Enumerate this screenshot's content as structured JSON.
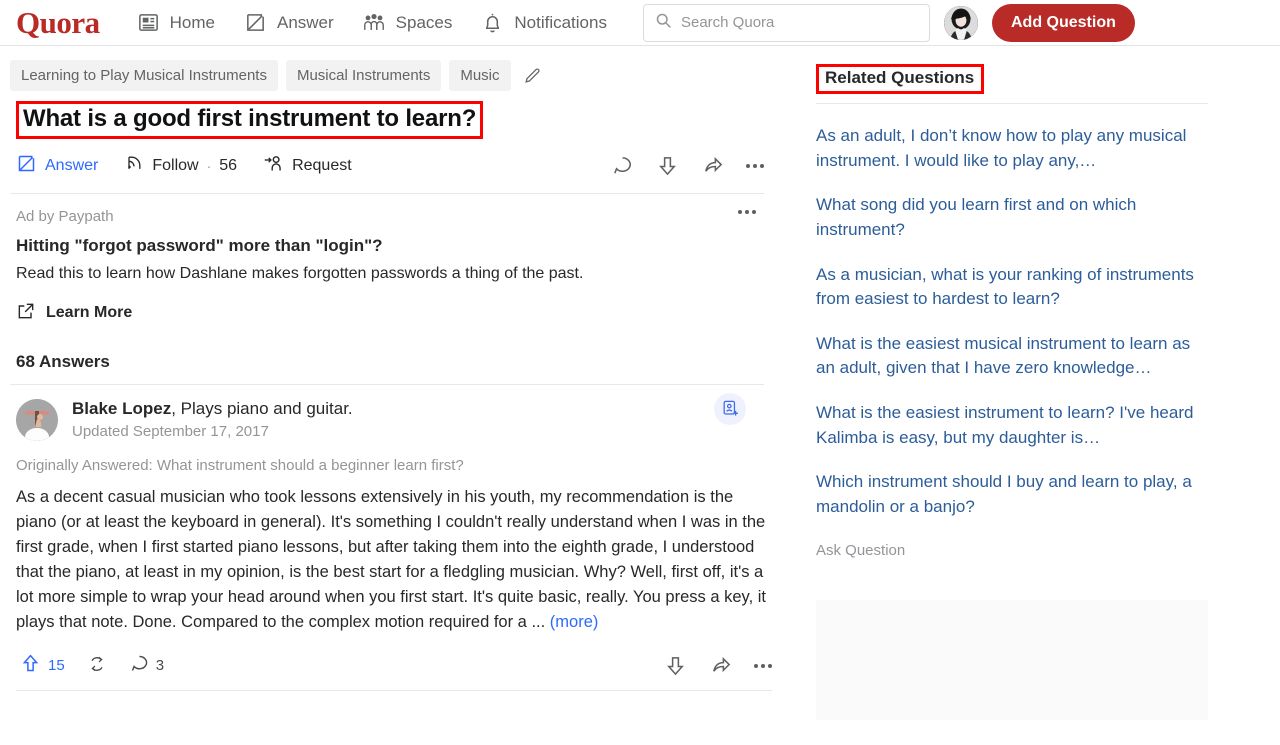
{
  "brand": {
    "logo_text": "Quora",
    "logo_color": "#b92b27",
    "link_color": "#2c5d99",
    "accent_blue": "#2e69ff",
    "annotation_color": "#ff0000"
  },
  "topnav": {
    "items": [
      {
        "label": "Home",
        "icon": "home-feed-icon"
      },
      {
        "label": "Answer",
        "icon": "answer-pencil-icon"
      },
      {
        "label": "Spaces",
        "icon": "spaces-people-icon"
      },
      {
        "label": "Notifications",
        "icon": "bell-icon"
      }
    ],
    "search": {
      "placeholder": "Search Quora",
      "value": "",
      "icon": "search-icon"
    },
    "profile_avatar": "user-avatar",
    "add_question_label": "Add Question"
  },
  "question": {
    "topics": [
      "Learning to Play Musical Instruments",
      "Musical Instruments",
      "Music"
    ],
    "edit_icon": "pencil-edit-icon",
    "title": "What is a good first instrument to learn?",
    "actions": {
      "answer_label": "Answer",
      "follow_label": "Follow",
      "follow_separator": "·",
      "follow_count": "56",
      "request_label": "Request",
      "icons": [
        "comment-icon",
        "downvote-icon",
        "share-icon",
        "more-options-icon"
      ]
    }
  },
  "ad": {
    "label": "Ad by Paypath",
    "title": "Hitting \"forgot password\" more than \"login\"?",
    "description": "Read this to learn how Dashlane makes forgotten passwords a thing of the past.",
    "cta_label": "Learn More",
    "cta_icon": "external-link-icon",
    "more_icon": "more-options-icon"
  },
  "answers": {
    "count_label": "68 Answers",
    "list": [
      {
        "author_name": "Blake Lopez",
        "author_bio": ", Plays piano and guitar.",
        "updated": "Updated September 17, 2017",
        "originally_answered": "Originally Answered: What instrument should a beginner learn first?",
        "body": "As a decent casual musician who took lessons extensively in his youth, my recommendation is the piano (or at least the keyboard in general). It's something I couldn't really understand when I was in the first grade, when I first started piano lessons, but after taking them into the eighth grade, I understood that the piano, at least in my opinion, is the best start for a fledgling musician. Why? Well, first off, it's a lot more simple to wrap your head around when you first start. It's quite basic, really. You press a key, it plays that note. Done. Compared to the complex motion required for a ...",
        "more_label": "(more)",
        "upvote_count": "15",
        "comment_count": "3",
        "follow_user_icon": "add-person-badge-icon",
        "footer_icons": [
          "upvote-icon",
          "repost-icon",
          "comment-icon",
          "downvote-icon",
          "share-icon",
          "more-options-icon"
        ]
      }
    ]
  },
  "sidebar": {
    "related_heading": "Related Questions",
    "related_questions": [
      "As an adult, I don’t know how to play any musical instrument. I would like to play any,…",
      "What song did you learn first and on which instrument?",
      "As a musician, what is your ranking of instruments from easiest to hardest to learn?",
      "What is the easiest musical instrument to learn as an adult, given that I have zero knowledge…",
      "What is the easiest instrument to learn? I've heard Kalimba is easy, but my daughter is…",
      "Which instrument should I buy and learn to play, a mandolin or a banjo?"
    ],
    "ask_question_label": "Ask Question"
  }
}
